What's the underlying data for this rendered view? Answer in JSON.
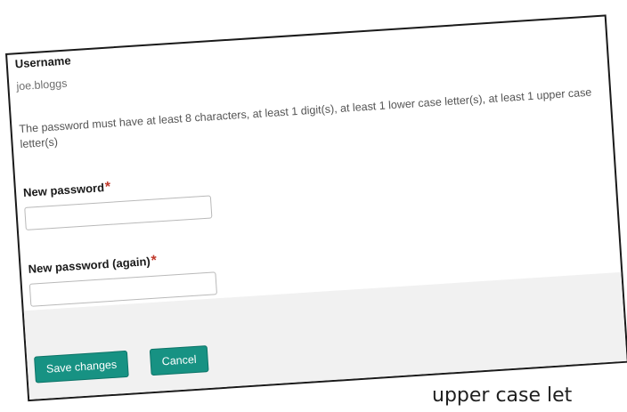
{
  "form": {
    "username_label": "Username",
    "username_value": "joe.bloggs",
    "password_hint": "The password must have at least 8 characters, at least 1 digit(s), at least 1 lower case letter(s), at least 1 upper case letter(s)",
    "new_password_label": "New password",
    "new_password_again_label": "New password (again)",
    "required_marker": "*",
    "new_password_value": "",
    "new_password_again_value": ""
  },
  "actions": {
    "save_label": "Save changes",
    "cancel_label": "Cancel"
  },
  "caption": {
    "text": "upper case let"
  },
  "colors": {
    "button_teal": "#179283",
    "required_red": "#c0392b",
    "footer_gray": "#f1f1f1"
  }
}
